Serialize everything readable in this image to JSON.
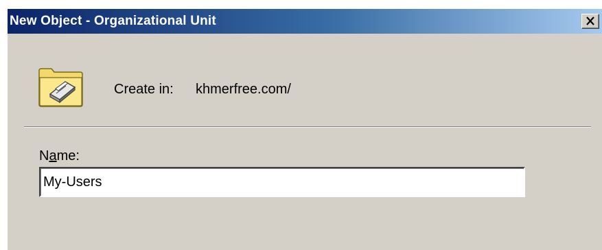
{
  "window": {
    "title": "New Object - Organizational Unit",
    "close_glyph": "close-icon"
  },
  "header": {
    "icon": "organizational-unit-folder-icon",
    "create_in_label": "Create in:",
    "create_in_value": "khmerfree.com/"
  },
  "form": {
    "name_label_prefix": "N",
    "name_label_accel": "a",
    "name_label_suffix": "me:",
    "name_value": "My-Users"
  },
  "colors": {
    "titlebar_start": "#0a246a",
    "titlebar_end": "#a6caf0",
    "dialog_face": "#d4d0c8"
  }
}
